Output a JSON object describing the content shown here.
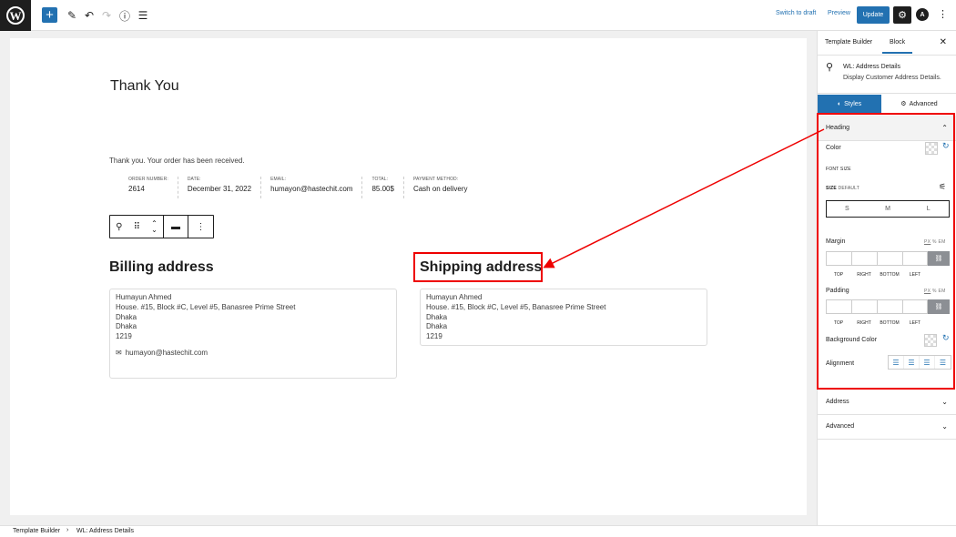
{
  "topbar": {
    "logo": "W",
    "add_icon": "+",
    "tools_icon": "pencil-icon",
    "undo_icon": "undo-icon",
    "redo_icon": "redo-icon",
    "info_icon": "info-icon",
    "list_view_icon": "list-view-icon",
    "switch_to_draft": "Switch to draft",
    "preview": "Preview",
    "update": "Update"
  },
  "page": {
    "title": "Thank You",
    "order_message": "Thank you. Your order has been received.",
    "overview": [
      {
        "label": "ORDER NUMBER:",
        "value": "2614"
      },
      {
        "label": "DATE:",
        "value": "December 31, 2022"
      },
      {
        "label": "EMAIL:",
        "value": "humayon@hastechit.com"
      },
      {
        "label": "TOTAL:",
        "value": "85.00$"
      },
      {
        "label": "PAYMENT METHOD:",
        "value": "Cash on delivery"
      }
    ],
    "billing": {
      "heading": "Billing address",
      "lines": [
        "Humayun Ahmed",
        "House. #15, Block #C, Level #5, Banasree Prime Street",
        "Dhaka",
        "Dhaka",
        "1219"
      ],
      "email": "humayon@hastechit.com"
    },
    "shipping": {
      "heading": "Shipping address",
      "lines": [
        "Humayun Ahmed",
        "House. #15, Block #C, Level #5, Banasree Prime Street",
        "Dhaka",
        "Dhaka",
        "1219"
      ]
    }
  },
  "sidebar": {
    "tab_template": "Template Builder",
    "tab_block": "Block",
    "block_title": "WL: Address Details",
    "block_desc": "Display Customer Address Details.",
    "styles_tab": "Styles",
    "advanced_tab": "Advanced",
    "heading_panel": "Heading",
    "color_label": "Color",
    "font_size_label": "FONT SIZE",
    "size_label": "SIZE",
    "size_default": "DEFAULT",
    "sizes": [
      "S",
      "M",
      "L"
    ],
    "margin_label": "Margin",
    "padding_label": "Padding",
    "units": [
      "PX",
      "%",
      "EM"
    ],
    "box_sides": [
      "TOP",
      "RIGHT",
      "BOTTOM",
      "LEFT"
    ],
    "bg_color_label": "Background Color",
    "alignment_label": "Alignment",
    "address_panel": "Address",
    "advanced_panel": "Advanced"
  },
  "footer": {
    "crumb_1": "Template Builder",
    "crumb_2": "WL: Address Details"
  },
  "colors": {
    "accent": "#2271b1",
    "highlight": "#ee0000"
  }
}
